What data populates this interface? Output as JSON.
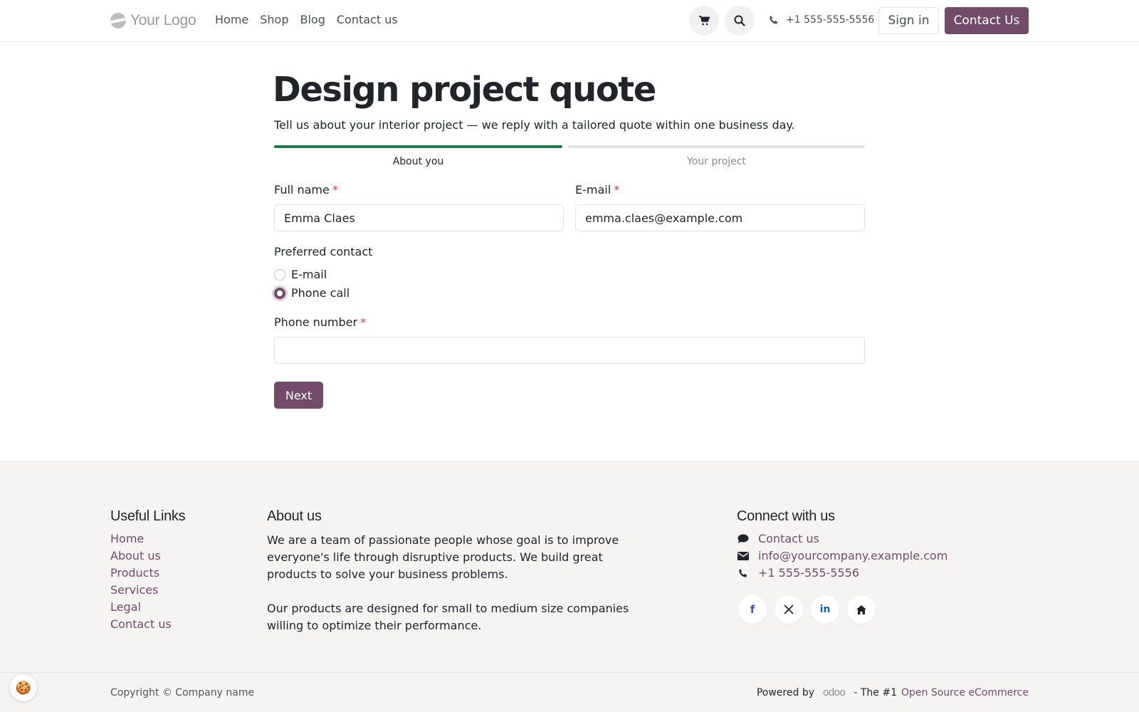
{
  "header": {
    "logo_text": "Your Logo",
    "nav": [
      "Home",
      "Shop",
      "Blog",
      "Contact us"
    ],
    "phone": "+1 555-555-5556",
    "signin_label": "Sign in",
    "cta_label": "Contact Us",
    "cart_icon": "cart-icon",
    "search_icon": "search-icon"
  },
  "main": {
    "title": "Design project quote",
    "subtitle": "Tell us about your interior project — we reply with a tailored quote within one business day.",
    "steps": [
      {
        "label": "About you",
        "active": true
      },
      {
        "label": "Your project",
        "active": false
      }
    ],
    "full_name": {
      "label": "Full name",
      "required_mark": "*",
      "value": "Emma Claes"
    },
    "email": {
      "label": "E-mail",
      "required_mark": "*",
      "value": "emma.claes@example.com"
    },
    "preferred_contact": {
      "label": "Preferred contact",
      "options": [
        {
          "label": "E-mail",
          "checked": false
        },
        {
          "label": "Phone call",
          "checked": true
        }
      ]
    },
    "phone_number": {
      "label": "Phone number",
      "required_mark": "*",
      "value": ""
    },
    "next_label": "Next"
  },
  "footer": {
    "useful_links": {
      "heading": "Useful Links",
      "items": [
        "Home",
        "About us",
        "Products",
        "Services",
        "Legal",
        "Contact us"
      ]
    },
    "about": {
      "heading": "About us",
      "p1": "We are a team of passionate people whose goal is to improve everyone's life through disruptive products. We build great products to solve your business problems.",
      "p2": "Our products are designed for small to medium size companies willing to optimize their performance."
    },
    "connect": {
      "heading": "Connect with us",
      "contact": "Contact us",
      "email": "info@yourcompany.example.com",
      "phone": "+1 555-555-5556"
    },
    "copyright": "Copyright © Company name",
    "powered_by": "Powered by",
    "odoo": "odoo",
    "tagline": "- The #1",
    "tagline_link": "Open Source eCommerce"
  },
  "colors": {
    "brand": "#714b67",
    "progress_active": "#1e7a4c",
    "required": "#dc3545"
  }
}
